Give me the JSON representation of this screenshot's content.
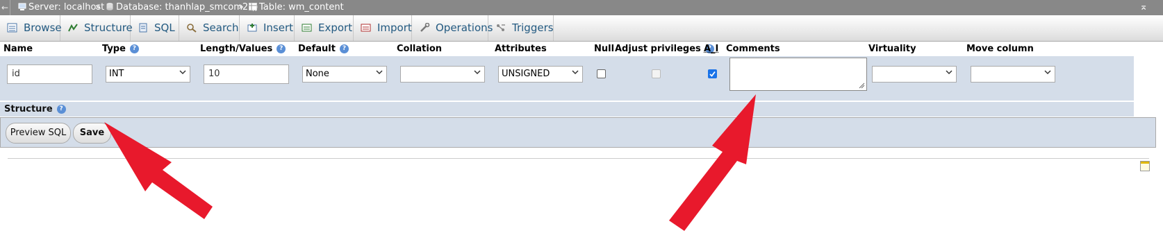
{
  "breadcrumb": {
    "server": "Server: localhost",
    "database": "Database: thanhlap_smcom2 ()",
    "table": "Table: wm_content",
    "separator": "»"
  },
  "tabs": [
    {
      "label": "Browse",
      "icon": "browse-icon"
    },
    {
      "label": "Structure",
      "icon": "structure-icon"
    },
    {
      "label": "SQL",
      "icon": "sql-icon"
    },
    {
      "label": "Search",
      "icon": "search-icon"
    },
    {
      "label": "Insert",
      "icon": "insert-icon"
    },
    {
      "label": "Export",
      "icon": "export-icon"
    },
    {
      "label": "Import",
      "icon": "import-icon"
    },
    {
      "label": "Operations",
      "icon": "wrench-icon"
    },
    {
      "label": "Triggers",
      "icon": "triggers-icon"
    }
  ],
  "columns": {
    "name": "Name",
    "type": "Type",
    "length": "Length/Values",
    "default": "Default",
    "collation": "Collation",
    "attributes": "Attributes",
    "null": "Null",
    "adjust_privileges": "Adjust privileges",
    "ai": "A_I",
    "comments": "Comments",
    "virtuality": "Virtuality",
    "move_column": "Move column"
  },
  "row": {
    "name_value": "id",
    "type_value": "INT",
    "length_value": "10",
    "default_value": "None",
    "collation_value": "",
    "attributes_value": "UNSIGNED",
    "null_checked": false,
    "adjust_privileges_checked": false,
    "ai_checked": true,
    "comments_value": "",
    "virtuality_value": "",
    "move_column_value": ""
  },
  "structure_label": "Structure",
  "actions": {
    "preview_sql": "Preview SQL",
    "save": "Save"
  },
  "colors": {
    "tab_text": "#235a81",
    "row_bg": "#d4dde9",
    "arrow": "#e8192c",
    "checkbox_checked": "#1a73e8"
  }
}
